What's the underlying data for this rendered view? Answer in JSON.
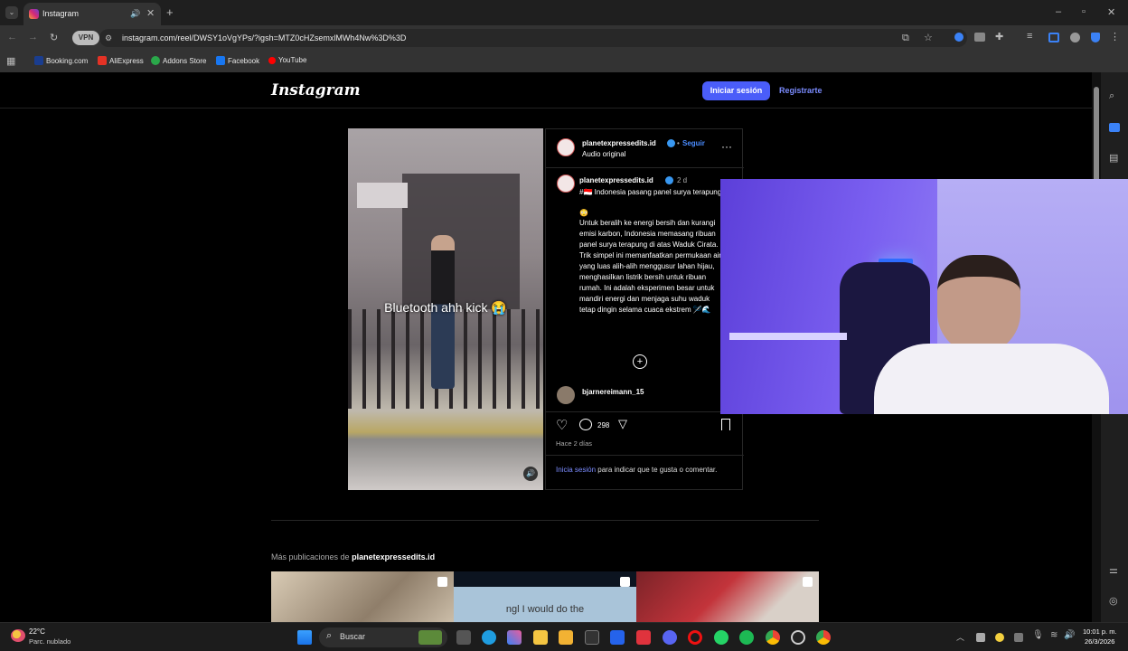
{
  "browser": {
    "tab_title": "Instagram",
    "url": "instagram.com/reel/DWSY1oVgYPs/?igsh=MTZ0cHZsemxlMWh4Nw%3D%3D",
    "bookmarks": [
      "Booking.com",
      "AliExpress",
      "Addons Store",
      "Facebook",
      "YouTube"
    ]
  },
  "instagram": {
    "logo": "Instagram",
    "login_label": "Iniciar sesión",
    "signup_label": "Registrarte",
    "video_caption": "Bluetooth ahh kick 😭",
    "post": {
      "username": "planetexpressedits.id",
      "follow_label": "Seguir",
      "audio": "Audio original",
      "time": "2 d",
      "caption_line1": "#🇮🇩 Indonesia pasang panel surya terapung",
      "caption_emoji": "😳",
      "caption_body": "Untuk beralih ke energi bersih dan kurangi emisi karbon, Indonesia memasang ribuan panel surya terapung di atas Waduk Cirata. Trik simpel ini memanfaatkan permukaan air yang luas alih-alih menggusur lahan hijau, menghasilkan listrik bersih untuk ribuan rumah. Ini adalah eksperimen besar untuk mandiri energi dan menjaga suhu waduk tetap dingin selama cuaca ekstrem 🪡🌊",
      "commenter": "bjarnereimann_15",
      "comment_count": "298",
      "posted_ago": "Hace 2 días",
      "login_prompt_link": "Inicia sesión",
      "login_prompt_rest": "para indicar que te gusta o comentar."
    },
    "more_posts_prefix": "Más publicaciones de",
    "more_posts_user": "planetexpressedits.id",
    "thumb2_caption": "ngl I would do the"
  },
  "taskbar": {
    "temperature": "22°C",
    "weather": "Parc. nublado",
    "search_placeholder": "Buscar",
    "time": "10:01 p. m.",
    "date": "26/3/2026"
  },
  "colors": {
    "accent": "#4a5df9",
    "link": "#7b8cff",
    "verified": "#3897f0"
  }
}
